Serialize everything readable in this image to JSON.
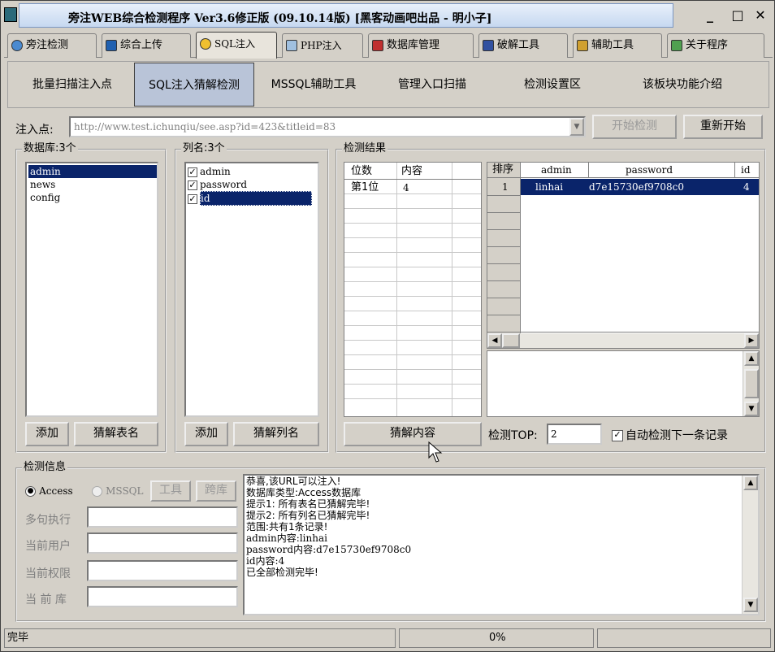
{
  "window": {
    "title": "旁注WEB综合检测程序 Ver3.6修正版 (09.10.14版) [黑客动画吧出品 - 明小子]",
    "minimize": "_",
    "maximize": "□",
    "close": "✕"
  },
  "tabs": [
    "旁注检测",
    "综合上传",
    "SQL注入",
    "PHP注入",
    "数据库管理",
    "破解工具",
    "辅助工具",
    "关于程序"
  ],
  "subtabs": [
    "批量扫描注入点",
    "SQL注入猜解检测",
    "MSSQL辅助工具",
    "管理入口扫描",
    "检测设置区",
    "该板块功能介绍"
  ],
  "inject": {
    "label": "注入点:",
    "url": "http://www.test.ichunqiu/see.asp?id=423&titleid=83",
    "start": "开始检测",
    "restart": "重新开始"
  },
  "db": {
    "title": "数据库:3个",
    "items": [
      "admin",
      "news",
      "config"
    ],
    "add": "添加",
    "guess": "猜解表名"
  },
  "cols": {
    "title": "列名:3个",
    "items": [
      "admin",
      "password",
      "id"
    ],
    "add": "添加",
    "guess": "猜解列名"
  },
  "result": {
    "title": "检测结果",
    "left_headers": [
      "位数",
      "内容"
    ],
    "left_rows": [
      [
        "第1位",
        "4"
      ]
    ],
    "guess": "猜解内容",
    "right_headers": [
      "排序",
      "admin",
      "password",
      "id"
    ],
    "right_rows": [
      [
        "1",
        "linhai",
        "d7e15730ef9708c0",
        "4"
      ]
    ],
    "top_label": "检测TOP:",
    "top_value": "2",
    "auto_label": "自动检测下一条记录"
  },
  "info": {
    "title": "检测信息",
    "access": "Access",
    "mssql": "MSSQL",
    "tool": "工具",
    "crossdb": "跨库",
    "multi": "多句执行",
    "user": "当前用户",
    "perm": "当前权限",
    "curdb": "当 前 库",
    "log": [
      "恭喜,该URL可以注入!",
      "数据库类型:Access数据库",
      "提示1: 所有表名已猜解完毕!",
      "提示2: 所有列名已猜解完毕!",
      "范围:共有1条记录!",
      "admin内容:linhai",
      "password内容:d7e15730ef9708c0",
      "id内容:4",
      "已全部检测完毕!"
    ]
  },
  "status": {
    "left": "完毕",
    "progress": "0%"
  },
  "colors": {
    "selection": "#0a246a",
    "face": "#d4d0c8",
    "title_bg": "#c6d8f0"
  }
}
